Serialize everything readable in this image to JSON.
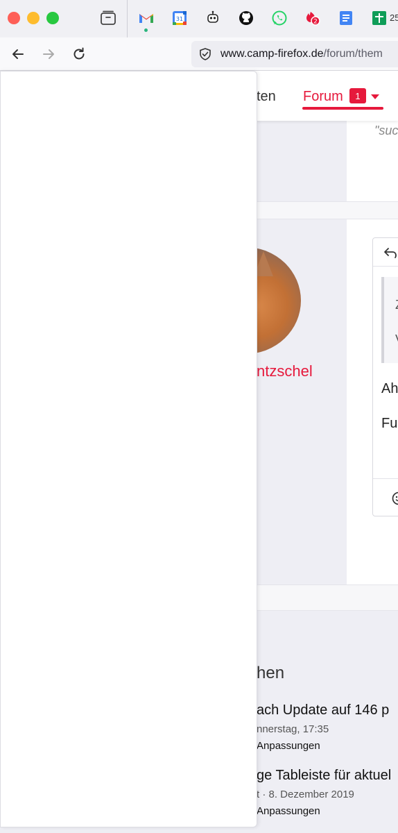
{
  "browser": {
    "pinned_tabs": [
      {
        "name": "gmail-icon"
      },
      {
        "name": "google-calendar-icon",
        "label": "31"
      },
      {
        "name": "chatbot-icon"
      },
      {
        "name": "github-icon"
      },
      {
        "name": "whatsapp-icon"
      },
      {
        "name": "notifications-icon",
        "badge": "2"
      },
      {
        "name": "google-docs-icon"
      },
      {
        "name": "google-sheets-icon",
        "label": "25"
      }
    ],
    "url_domain": "www.camp-firefox.de",
    "url_path": "/forum/them"
  },
  "site_nav": {
    "item_partial": "ten",
    "forum_label": "Forum",
    "forum_badge": "1",
    "accent_color": "#e6193c"
  },
  "post1": {
    "quote_fragment": "\"suc"
  },
  "post2": {
    "username_partial": "ntzschel",
    "quote_char1": "Z",
    "quote_char2": "V",
    "text_line1": "Ah",
    "text_line2": "Fu"
  },
  "related": {
    "heading_partial": "hen",
    "items": [
      {
        "title": "ach Update auf 146 p",
        "meta": "nnerstag, 17:35",
        "category": "Anpassungen"
      },
      {
        "title": "ge Tableiste für aktuel",
        "meta": "t · 8. Dezember 2019",
        "category": "Anpassungen"
      }
    ]
  }
}
